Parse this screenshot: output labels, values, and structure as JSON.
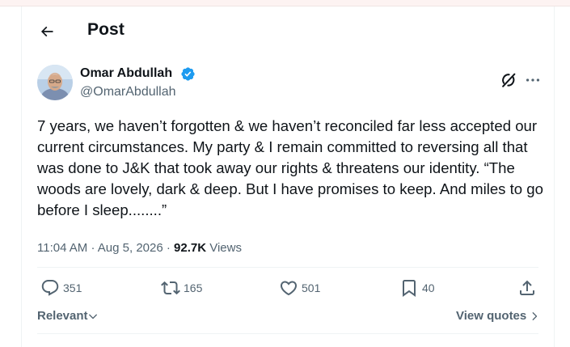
{
  "header": {
    "title": "Post"
  },
  "author": {
    "name": "Omar Abdullah",
    "handle": "@OmarAbdullah"
  },
  "tweet": {
    "text": "7 years, we haven’t forgotten & we haven’t reconciled far less accepted our current circumstances. My party & I remain committed to reversing all that was done to J&K that took away our rights & threatens our identity. “The woods are lovely, dark & deep. But I have promises to keep. And miles to go before I sleep........”",
    "time": "11:04 AM",
    "separator": "·",
    "date": "Aug 5, 2026",
    "views_count": "92.7K",
    "views_label": "Views"
  },
  "actions": {
    "replies": "351",
    "reposts": "165",
    "likes": "501",
    "bookmarks": "40"
  },
  "footer": {
    "sort_label": "Relevant",
    "view_quotes_label": "View quotes"
  },
  "colors": {
    "verified": "#1d9bf0",
    "secondary_text": "#536471",
    "primary_text": "#0f1419",
    "divider": "#eff3f4"
  }
}
